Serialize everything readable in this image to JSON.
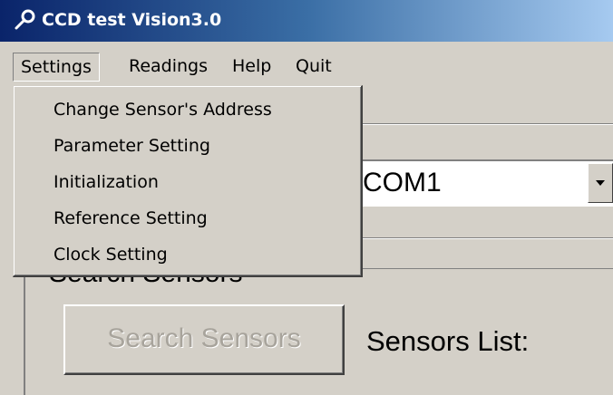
{
  "window": {
    "title": "CCD test Vision3.0",
    "icon": "key-wrench-icon"
  },
  "menubar": {
    "items": [
      {
        "label": "Settings",
        "open": true
      },
      {
        "label": "Readings"
      },
      {
        "label": "Help"
      },
      {
        "label": "Quit"
      }
    ]
  },
  "settings_menu": {
    "items": [
      {
        "label": "Change Sensor's Address"
      },
      {
        "label": "Parameter Setting"
      },
      {
        "label": "Initialization"
      },
      {
        "label": "Reference Setting"
      },
      {
        "label": "Clock Setting"
      }
    ]
  },
  "port_select": {
    "value": "COM1",
    "icon": "dropdown-arrow-icon"
  },
  "search_group": {
    "label": "Search Sensors",
    "button_label": "Search Sensors",
    "button_enabled": false,
    "list_label": "Sensors List:"
  },
  "colors": {
    "face": "#d4d0c8",
    "title_start": "#0a246a",
    "title_end": "#a6caf0",
    "disabled_text": "#a8a49c"
  }
}
